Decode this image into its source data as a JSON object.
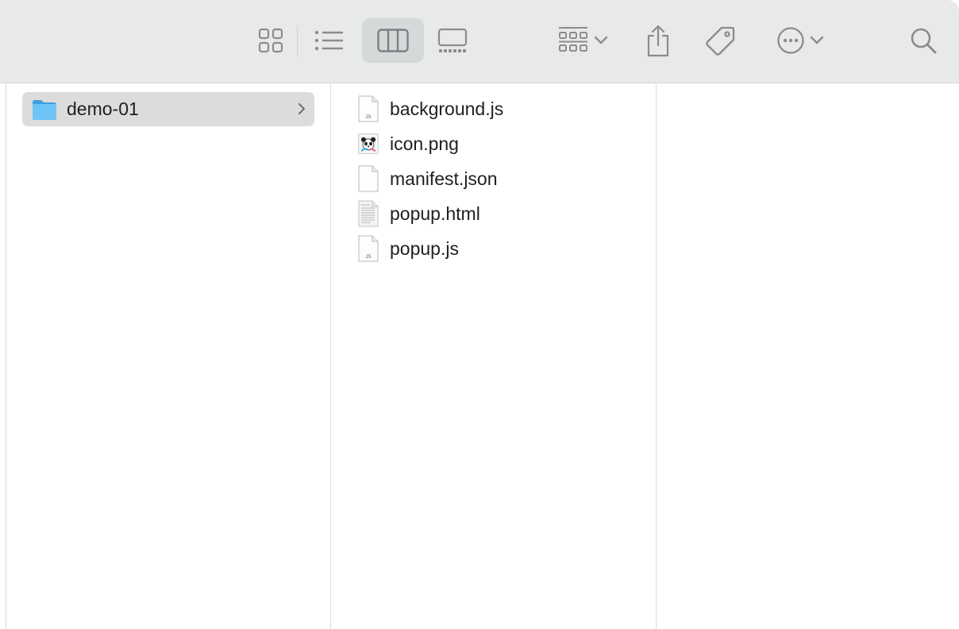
{
  "toolbar": {
    "buttons": [
      {
        "name": "icon-view-button",
        "icon": "grid-icon"
      },
      {
        "name": "list-view-button",
        "icon": "list-icon"
      },
      {
        "name": "column-view-button",
        "icon": "columns-icon",
        "active": true
      },
      {
        "name": "gallery-view-button",
        "icon": "gallery-icon"
      },
      {
        "name": "group-button",
        "icon": "group-grid-icon"
      },
      {
        "name": "share-button",
        "icon": "share-icon"
      },
      {
        "name": "tag-button",
        "icon": "tag-icon"
      },
      {
        "name": "more-actions-button",
        "icon": "ellipsis-circle-icon"
      },
      {
        "name": "search-button",
        "icon": "search-icon"
      }
    ]
  },
  "columns": {
    "first": {
      "items": [
        {
          "label": "demo-01",
          "type": "folder",
          "selected": true
        }
      ]
    },
    "second": {
      "items": [
        {
          "label": "background.js",
          "type": "js"
        },
        {
          "label": "icon.png",
          "type": "png"
        },
        {
          "label": "manifest.json",
          "type": "json"
        },
        {
          "label": "popup.html",
          "type": "html"
        },
        {
          "label": "popup.js",
          "type": "js"
        }
      ]
    }
  },
  "colors": {
    "toolbar_bg": "#e8eaea",
    "selection_bg": "#dcdcdc",
    "folder_blue": "#5ab8f0",
    "icon_gray": "#8a8c8e"
  }
}
